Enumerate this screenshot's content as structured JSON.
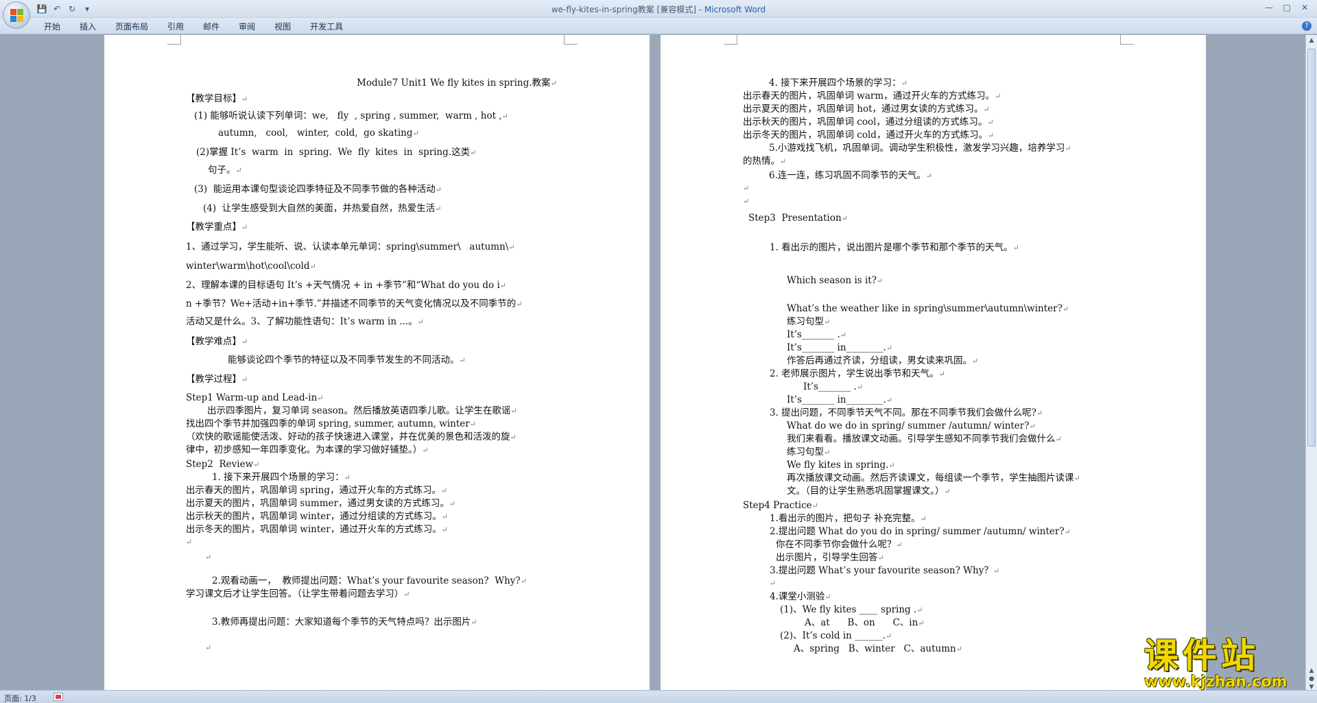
{
  "window": {
    "title_doc": "we-fly-kites-in-spring教案 [兼容模式] - ",
    "title_app": "Microsoft Word"
  },
  "ribbon": {
    "tabs": [
      "开始",
      "插入",
      "页面布局",
      "引用",
      "邮件",
      "审阅",
      "视图",
      "开发工具"
    ]
  },
  "status": {
    "page": "页面: 1/3"
  },
  "watermark": {
    "text": "课件站",
    "url": "www.kjzhan.com"
  },
  "page1": {
    "lines": [
      "Module7 Unit1 We fly kites in spring.教案",
      "【教学目标】",
      "(1) 能够听说认读下列单词：we,   fly  , spring , summer,  warm , hot ,",
      "autumn,   cool,   winter,  cold,  go skating",
      "(2)掌握 It’s  warm  in  spring.  We  fly  kites  in  spring.这类",
      "句子。",
      "(3)  能运用本课句型谈论四季特征及不同季节做的各种活动",
      "(4)  让学生感受到大自然的美面，并热爱自然，热爱生活",
      "【教学重点】",
      "1、通过学习，学生能听、说、认读本单元单词：spring\\summer\\   autumn\\",
      "winter\\warm\\hot\\cool\\cold",
      "2、理解本课的目标语句 It’s +天气情况 + in +季节”和“What do you do i",
      "n +季节？We+活动+in+季节.”并描述不同季节的天气变化情况以及不同季节的",
      "活动又是什么。3、了解功能性语句：It’s warm in ...。",
      "【教学难点】",
      "能够谈论四个季节的特征以及不同季节发生的不同活动。",
      "【教学过程】",
      "Step1 Warm-up and Lead-in",
      "出示四季图片，复习单词 season。然后播放英语四季儿歌。让学生在歌谣",
      "找出四个季节并加强四季的单词 spring, summer, autumn, winter",
      "（欢快的歌谣能使活泼、好动的孩子快速进入课堂，并在优美的景色和活泼的旋",
      "律中，初步感知一年四季变化。为本课的学习做好铺垫。）",
      "Step2  Review",
      "1. 接下来开展四个场景的学习：",
      "出示春天的图片，巩固单词 spring，通过开火车的方式练习。",
      "出示夏天的图片，巩固单词 summer，通过男女读的方式练习。",
      "出示秋天的图片，巩固单词 winter，通过分组读的方式练习。",
      "出示冬天的图片，巩固单词 winter，通过开火车的方式练习。",
      "2.观看动画一，  教师提出问题：What’s your favourite season?  Why?",
      "学习课文后才让学生回答。（让学生带着问题去学习）",
      "3.教师再提出问题：大家知道每个季节的天气特点吗？出示图片"
    ]
  },
  "page2": {
    "lines": [
      "4. 接下来开展四个场景的学习：",
      "出示春天的图片，巩固单词 warm，通过开火车的方式练习。",
      "出示夏天的图片，巩固单词 hot，通过男女读的方式练习。",
      "出示秋天的图片，巩固单词 cool，通过分组读的方式练习。",
      "出示冬天的图片，巩固单词 cold，通过开火车的方式练习。",
      "5.小游戏找飞机，巩固单词。调动学生积极性，激发学习兴趣，培养学习",
      "的热情。",
      "6.连一连，练习巩固不同季节的天气。",
      "Step3  Presentation",
      "1. 看出示的图片，说出图片是哪个季节和那个季节的天气。",
      "Which season is it?",
      "What’s the weather like in spring\\summer\\autumn\\winter?",
      "练习句型",
      "It’s_______ .",
      "It’s_______ in________.",
      "作答后再通过齐读，分组读，男女读来巩固。",
      "2. 老师展示图片，学生说出季节和天气。",
      "It’s_______ .",
      "It’s_______ in________.",
      "3. 提出问题，不同季节天气不同。那在不同季节我们会做什么呢?",
      "What do we do in spring/ summer /autumn/ winter?",
      "我们来看看。播放课文动画。引导学生感知不同季节我们会做什么",
      "练习句型",
      "We fly kites in spring.",
      "再次播放课文动画。然后齐读课文，每组读一个季节，学生抽图片读课",
      "文。（目的让学生熟悉巩固掌握课文。）",
      "Step4 Practice",
      "1.看出示的图片，把句子 补充完整。",
      "2.提出问题 What do you do in spring/ summer /autumn/ winter?",
      "你在不同季节你会做什么呢？",
      "出示图片，引导学生回答",
      "3.提出问题 What’s your favourite season? Why？",
      "4.课堂小测验",
      "(1)、We fly kites ____ spring .",
      "A、at      B、on      C、in",
      "(2)、It’s cold in ______.",
      "A、spring   B、winter   C、autumn"
    ]
  },
  "pilcrow": "↵"
}
